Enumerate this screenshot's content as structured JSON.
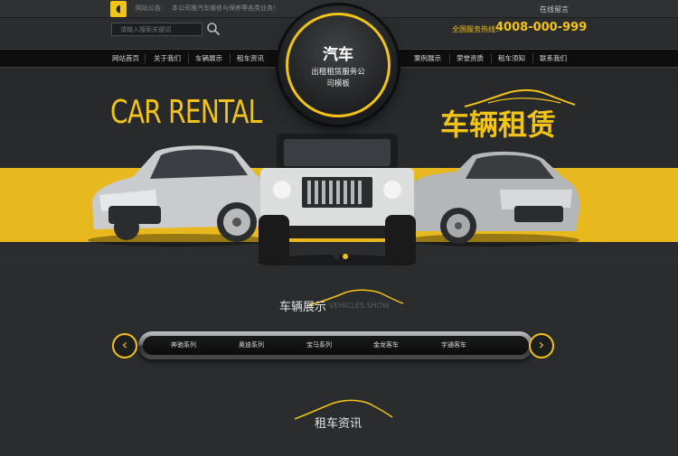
{
  "topbar": {
    "notice_label": "网站公告：",
    "notice_text": "本公司推汽车维修与保养等各类业务！",
    "online_message": "在线留言"
  },
  "header": {
    "search_placeholder": "请输入搜索关键词",
    "hotline_label": "全国服务热线：",
    "hotline_number": "4008-000-999"
  },
  "logo": {
    "title": "汽车",
    "subtitle_line1": "出租租赁服务公",
    "subtitle_line2": "司模板"
  },
  "nav": {
    "left": [
      "网站首页",
      "关于我们",
      "车辆展示",
      "租车资讯"
    ],
    "right": [
      "案例展示",
      "荣誉资质",
      "租车须知",
      "联系我们"
    ]
  },
  "banner": {
    "en_title": "CAR RENTAL",
    "cn_title": "车辆租赁",
    "accent_color": "#f2c318",
    "stripe_color": "#e8b91e",
    "active_slide": 2,
    "slide_count": 2
  },
  "vehicles": {
    "title": "车辆展示",
    "subtitle": "VEHICLES SHOW",
    "series": [
      "奔驰系列",
      "奥迪系列",
      "宝马系列",
      "金龙客车",
      "宇通客车"
    ],
    "prev_icon": "chevron-left-icon",
    "next_icon": "chevron-right-icon"
  },
  "news": {
    "title": "租车资讯"
  }
}
